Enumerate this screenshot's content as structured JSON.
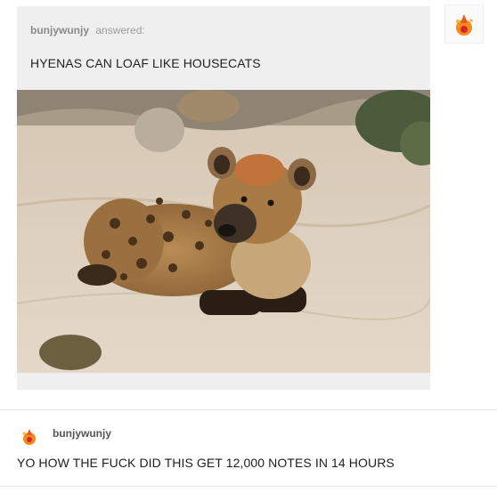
{
  "post": {
    "asker": "bunjywunjy",
    "verb": "answered:",
    "question": "HYENAS CAN LOAF LIKE HOUSECATS",
    "image_alt_icon": "hyena-photo"
  },
  "side": {
    "avatar_icon": "blog-avatar-icon"
  },
  "reply": {
    "username": "bunjywunjy",
    "text": "YO HOW THE FUCK DID THIS GET 12,000 NOTES IN 14 HOURS",
    "avatar_icon": "reply-avatar-icon"
  },
  "colors": {
    "card_bg": "#efefef",
    "accent_orange": "#f28c1e"
  }
}
